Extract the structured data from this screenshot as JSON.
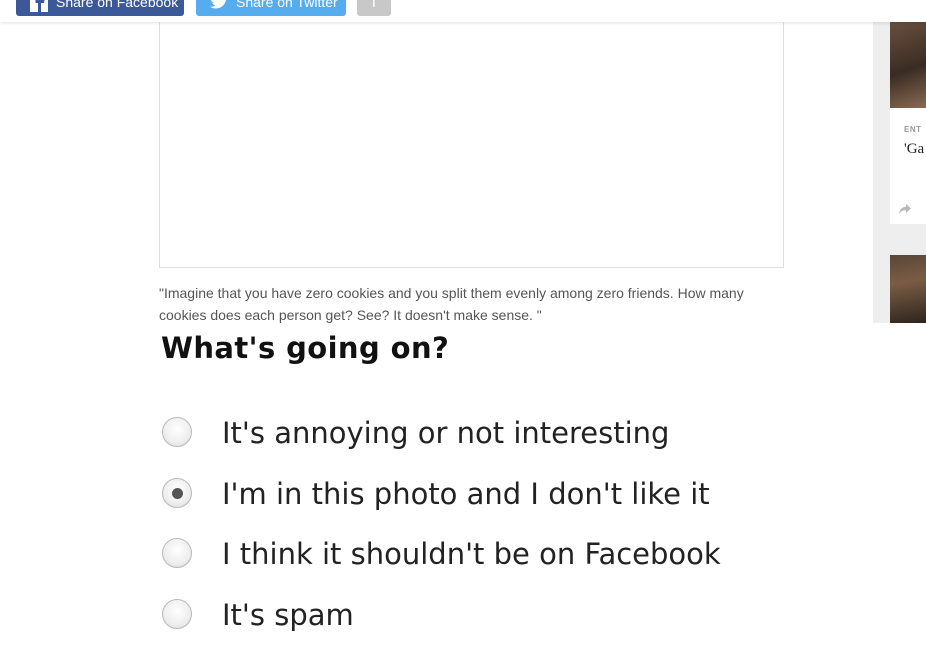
{
  "share_bar": {
    "facebook_label": "Share on Facebook",
    "twitter_label": "Share on Twitter",
    "more_label": "f",
    "facebook_color": "#3b5998",
    "twitter_color": "#55acee"
  },
  "article": {
    "caption": "\"Imagine that you have zero cookies and you split them evenly among zero friends. How many cookies does each person get? See? It doesn't make sense. \""
  },
  "report": {
    "title": "What's going on?",
    "options": [
      {
        "label": "It's annoying or not interesting",
        "selected": false
      },
      {
        "label": "I'm in this photo and I don't like it",
        "selected": true
      },
      {
        "label": "I think it shouldn't be on Facebook",
        "selected": false
      },
      {
        "label": "It's spam",
        "selected": false
      }
    ]
  },
  "sidebar": {
    "card": {
      "category": "ENT",
      "title": "'Ga on"
    }
  }
}
